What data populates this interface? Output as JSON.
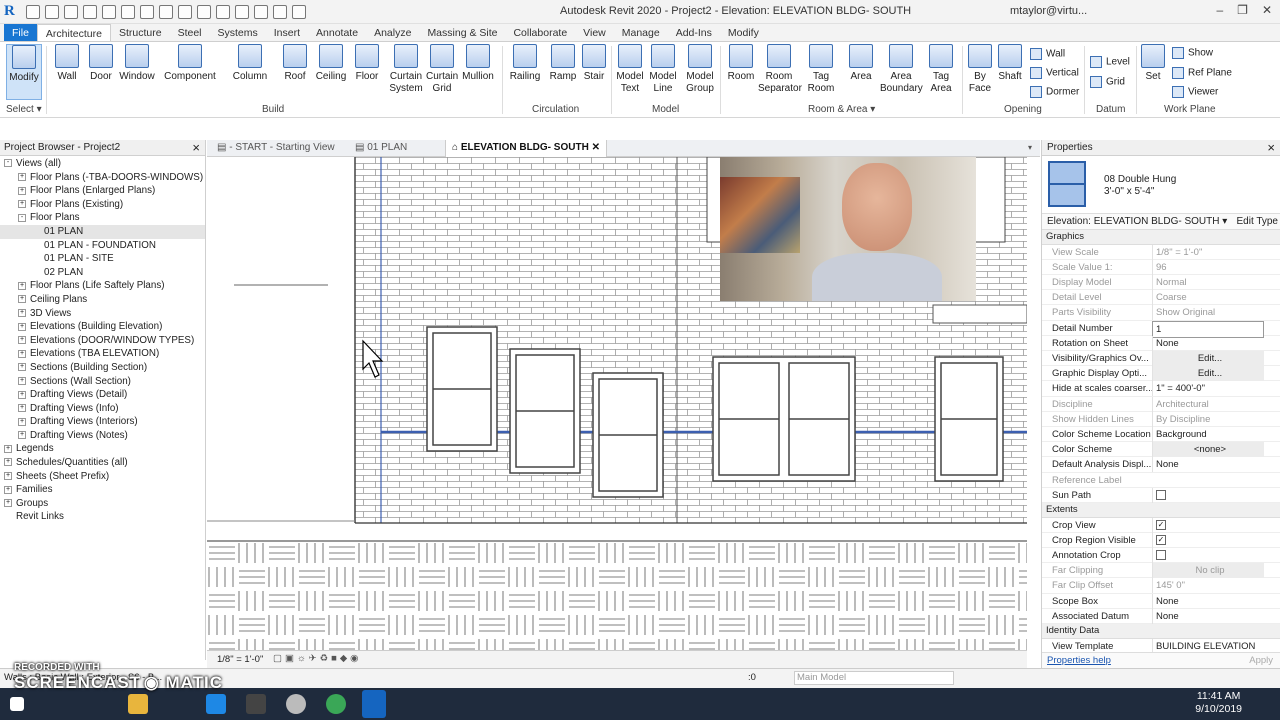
{
  "window": {
    "title": "Autodesk Revit 2020 - Project2 - Elevation: ELEVATION BLDG- SOUTH",
    "user": "mtaylor@virtu...",
    "app_logo": "R"
  },
  "menu_tabs": [
    "File",
    "Architecture",
    "Structure",
    "Steel",
    "Systems",
    "Insert",
    "Annotate",
    "Analyze",
    "Massing & Site",
    "Collaborate",
    "View",
    "Manage",
    "Add-Ins",
    "Modify"
  ],
  "ribbon": {
    "buttons": [
      {
        "label": "Modify",
        "icon": "cursor-icon"
      },
      {
        "label": "Wall",
        "icon": "wall-icon"
      },
      {
        "label": "Door",
        "icon": "door-icon"
      },
      {
        "label": "Window",
        "icon": "window-icon"
      },
      {
        "label": "Component",
        "icon": "component-icon"
      },
      {
        "label": "Column",
        "icon": "column-icon"
      },
      {
        "label": "Roof",
        "icon": "roof-icon"
      },
      {
        "label": "Ceiling",
        "icon": "ceiling-icon"
      },
      {
        "label": "Floor",
        "icon": "floor-icon"
      },
      {
        "label": "Curtain System",
        "icon": "curtain-system-icon"
      },
      {
        "label": "Curtain Grid",
        "icon": "curtain-grid-icon"
      },
      {
        "label": "Mullion",
        "icon": "mullion-icon"
      },
      {
        "label": "Railing",
        "icon": "railing-icon"
      },
      {
        "label": "Ramp",
        "icon": "ramp-icon"
      },
      {
        "label": "Stair",
        "icon": "stair-icon"
      },
      {
        "label": "Model Text",
        "icon": "model-text-icon"
      },
      {
        "label": "Model Line",
        "icon": "model-line-icon"
      },
      {
        "label": "Model Group",
        "icon": "model-group-icon"
      },
      {
        "label": "Room",
        "icon": "room-icon"
      },
      {
        "label": "Room Separator",
        "icon": "room-separator-icon"
      },
      {
        "label": "Tag Room",
        "icon": "tag-room-icon"
      },
      {
        "label": "Area",
        "icon": "area-icon"
      },
      {
        "label": "Area Boundary",
        "icon": "area-boundary-icon"
      },
      {
        "label": "Tag Area",
        "icon": "tag-area-icon"
      },
      {
        "label": "By Face",
        "icon": "by-face-icon"
      },
      {
        "label": "Shaft",
        "icon": "shaft-icon"
      },
      {
        "label": "Set",
        "icon": "set-icon"
      }
    ],
    "small_buttons": [
      "Wall",
      "Vertical",
      "Dormer",
      "Level",
      "Grid",
      "Show",
      "Ref  Plane",
      "Viewer"
    ],
    "panels": [
      "Select",
      "Build",
      "Circulation",
      "Model",
      "Room & Area",
      "Opening",
      "Datum",
      "Work Plane"
    ]
  },
  "project_browser": {
    "title": "Project Browser - Project2",
    "items": [
      {
        "label": "Views (all)",
        "level": 0,
        "exp": "-"
      },
      {
        "label": "Floor Plans (-TBA-DOORS-WINDOWS)",
        "level": 1,
        "exp": "+"
      },
      {
        "label": "Floor Plans (Enlarged Plans)",
        "level": 1,
        "exp": "+"
      },
      {
        "label": "Floor Plans (Existing)",
        "level": 1,
        "exp": "+"
      },
      {
        "label": "Floor Plans",
        "level": 1,
        "exp": "-"
      },
      {
        "label": "01 PLAN",
        "level": 2,
        "exp": "",
        "selected": true
      },
      {
        "label": "01 PLAN - FOUNDATION",
        "level": 2,
        "exp": ""
      },
      {
        "label": "01 PLAN - SITE",
        "level": 2,
        "exp": ""
      },
      {
        "label": "02 PLAN",
        "level": 2,
        "exp": ""
      },
      {
        "label": "Floor Plans (Life Saftely Plans)",
        "level": 1,
        "exp": "+"
      },
      {
        "label": "Ceiling Plans",
        "level": 1,
        "exp": "+"
      },
      {
        "label": "3D Views",
        "level": 1,
        "exp": "+"
      },
      {
        "label": "Elevations (Building Elevation)",
        "level": 1,
        "exp": "+"
      },
      {
        "label": "Elevations (DOOR/WINDOW TYPES)",
        "level": 1,
        "exp": "+"
      },
      {
        "label": "Elevations (TBA ELEVATION)",
        "level": 1,
        "exp": "+"
      },
      {
        "label": "Sections (Building Section)",
        "level": 1,
        "exp": "+"
      },
      {
        "label": "Sections (Wall Section)",
        "level": 1,
        "exp": "+"
      },
      {
        "label": "Drafting Views (Detail)",
        "level": 1,
        "exp": "+"
      },
      {
        "label": "Drafting Views (Info)",
        "level": 1,
        "exp": "+"
      },
      {
        "label": "Drafting Views (Interiors)",
        "level": 1,
        "exp": "+"
      },
      {
        "label": "Drafting Views (Notes)",
        "level": 1,
        "exp": "+"
      },
      {
        "label": "Legends",
        "level": 0,
        "exp": "+"
      },
      {
        "label": "Schedules/Quantities (all)",
        "level": 0,
        "exp": "+"
      },
      {
        "label": "Sheets (Sheet Prefix)",
        "level": 0,
        "exp": "+"
      },
      {
        "label": "Families",
        "level": 0,
        "exp": "+"
      },
      {
        "label": "Groups",
        "level": 0,
        "exp": "+"
      },
      {
        "label": "Revit Links",
        "level": 0,
        "exp": ""
      }
    ]
  },
  "view_tabs": [
    {
      "label": "- START - Starting View",
      "active": false
    },
    {
      "label": "01 PLAN",
      "active": false
    },
    {
      "label": "ELEVATION BLDG- SOUTH",
      "active": true
    }
  ],
  "view_control": {
    "scale": "1/8\" = 1'-0\""
  },
  "properties": {
    "title": "Properties",
    "type_name": "08 Double Hung",
    "type_size": "3'-0\" x 5'-4\"",
    "filter": "Elevation: ELEVATION BLDG- SOUTH",
    "edit_type": "Edit Type",
    "groups": [
      {
        "name": "Graphics",
        "rows": [
          {
            "k": "View Scale",
            "v": "1/8\" = 1'-0\"",
            "dis": true
          },
          {
            "k": "Scale Value    1:",
            "v": "96",
            "dis": true
          },
          {
            "k": "Display Model",
            "v": "Normal",
            "dis": true
          },
          {
            "k": "Detail Level",
            "v": "Coarse",
            "dis": true
          },
          {
            "k": "Parts Visibility",
            "v": "Show Original",
            "dis": true
          },
          {
            "k": "Detail Number",
            "v": "1",
            "box": true
          },
          {
            "k": "Rotation on Sheet",
            "v": "None"
          },
          {
            "k": "Visibility/Graphics Ov...",
            "v": "Edit...",
            "btn": true
          },
          {
            "k": "Graphic Display Opti...",
            "v": "Edit...",
            "btn": true
          },
          {
            "k": "Hide at scales coarser...",
            "v": "1\" = 400'-0\""
          },
          {
            "k": "Discipline",
            "v": "Architectural",
            "dis": true
          },
          {
            "k": "Show Hidden Lines",
            "v": "By Discipline",
            "dis": true
          },
          {
            "k": "Color Scheme Location",
            "v": "Background"
          },
          {
            "k": "Color Scheme",
            "v": "<none>",
            "btn": true
          },
          {
            "k": "Default Analysis Displ...",
            "v": "None"
          },
          {
            "k": "Reference Label",
            "v": "",
            "dis": true
          },
          {
            "k": "Sun Path",
            "v": "",
            "check": false
          }
        ]
      },
      {
        "name": "Extents",
        "rows": [
          {
            "k": "Crop View",
            "v": "",
            "check": true
          },
          {
            "k": "Crop Region Visible",
            "v": "",
            "check": true
          },
          {
            "k": "Annotation Crop",
            "v": "",
            "check": false
          },
          {
            "k": "Far Clipping",
            "v": "No clip",
            "dis": true,
            "btn": true
          },
          {
            "k": "Far Clip Offset",
            "v": "145'  0\"",
            "dis": true
          },
          {
            "k": "Scope Box",
            "v": "None"
          },
          {
            "k": "Associated Datum",
            "v": "None"
          }
        ]
      },
      {
        "name": "Identity Data",
        "rows": [
          {
            "k": "View Template",
            "v": "BUILDING ELEVATION"
          }
        ]
      }
    ],
    "help_link": "Properties help",
    "apply": "Apply"
  },
  "status_bar": {
    "text": "Walls : Basic Wall : Exterior - S6 - B...",
    "model": "Main Model",
    "zero": ":0"
  },
  "watermark": {
    "line1": "RECORDED WITH",
    "line2": "SCREENCAST",
    "line3": "MATIC"
  },
  "taskbar": {
    "time": "11:41 AM",
    "date": "9/10/2019"
  }
}
